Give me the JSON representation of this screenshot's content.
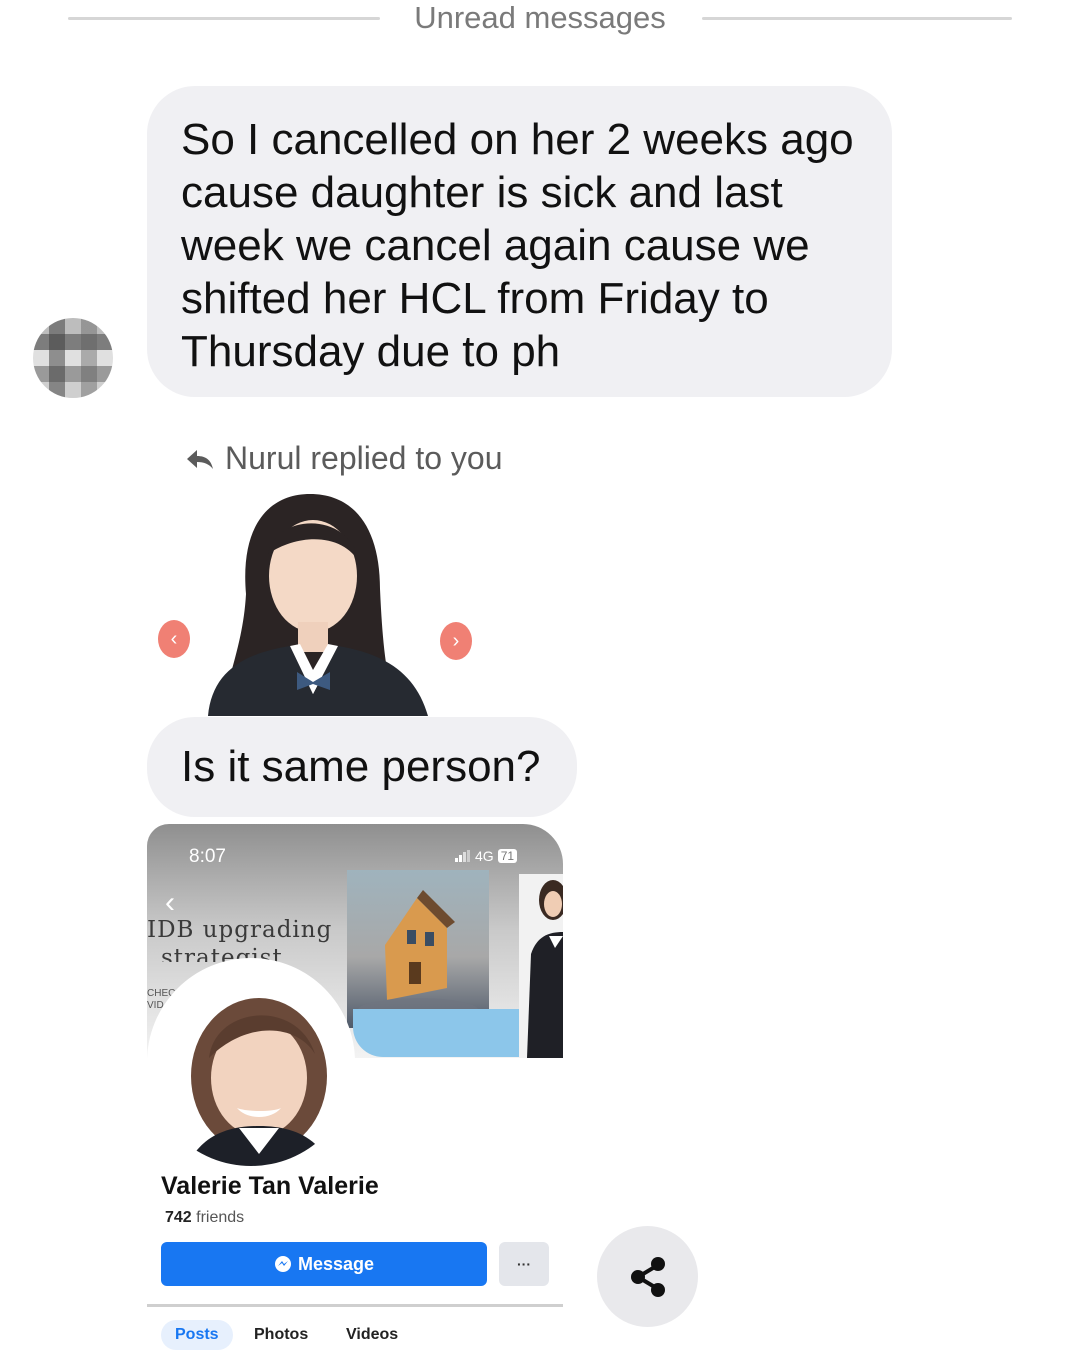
{
  "divider": {
    "label": "Unread messages"
  },
  "messages": {
    "first": "So I cancelled on her 2 weeks ago cause daughter is sick and last week we cancel again cause we shifted her HCL from Friday to Thursday due to ph",
    "reply_tag": "Nurul replied to you",
    "question": "Is it same person?"
  },
  "photo_card": {
    "prev_glyph": "‹",
    "next_glyph": "›"
  },
  "screenshot": {
    "status_time": "8:07",
    "network": "4G",
    "battery": "71",
    "back_glyph": "‹",
    "banner_title_1": "IDB upgrading",
    "banner_title_2": "strategist",
    "banner_small_1": "CHEC",
    "banner_small_2": "VID",
    "profile_name": "Valerie Tan Valerie",
    "friends_count": "742",
    "friends_label": "friends",
    "message_button": "Message",
    "more_button": "···",
    "tabs": [
      "Posts",
      "Photos",
      "Videos"
    ]
  },
  "icons": {
    "reply": "reply-arrow-icon",
    "share": "share-icon",
    "messenger": "messenger-icon",
    "search": "search-icon"
  },
  "colors": {
    "bubble": "#f0f0f3",
    "arrow_button": "#ee6a5c",
    "message_button": "#1877f2",
    "share_fab": "#e9e9ec"
  }
}
